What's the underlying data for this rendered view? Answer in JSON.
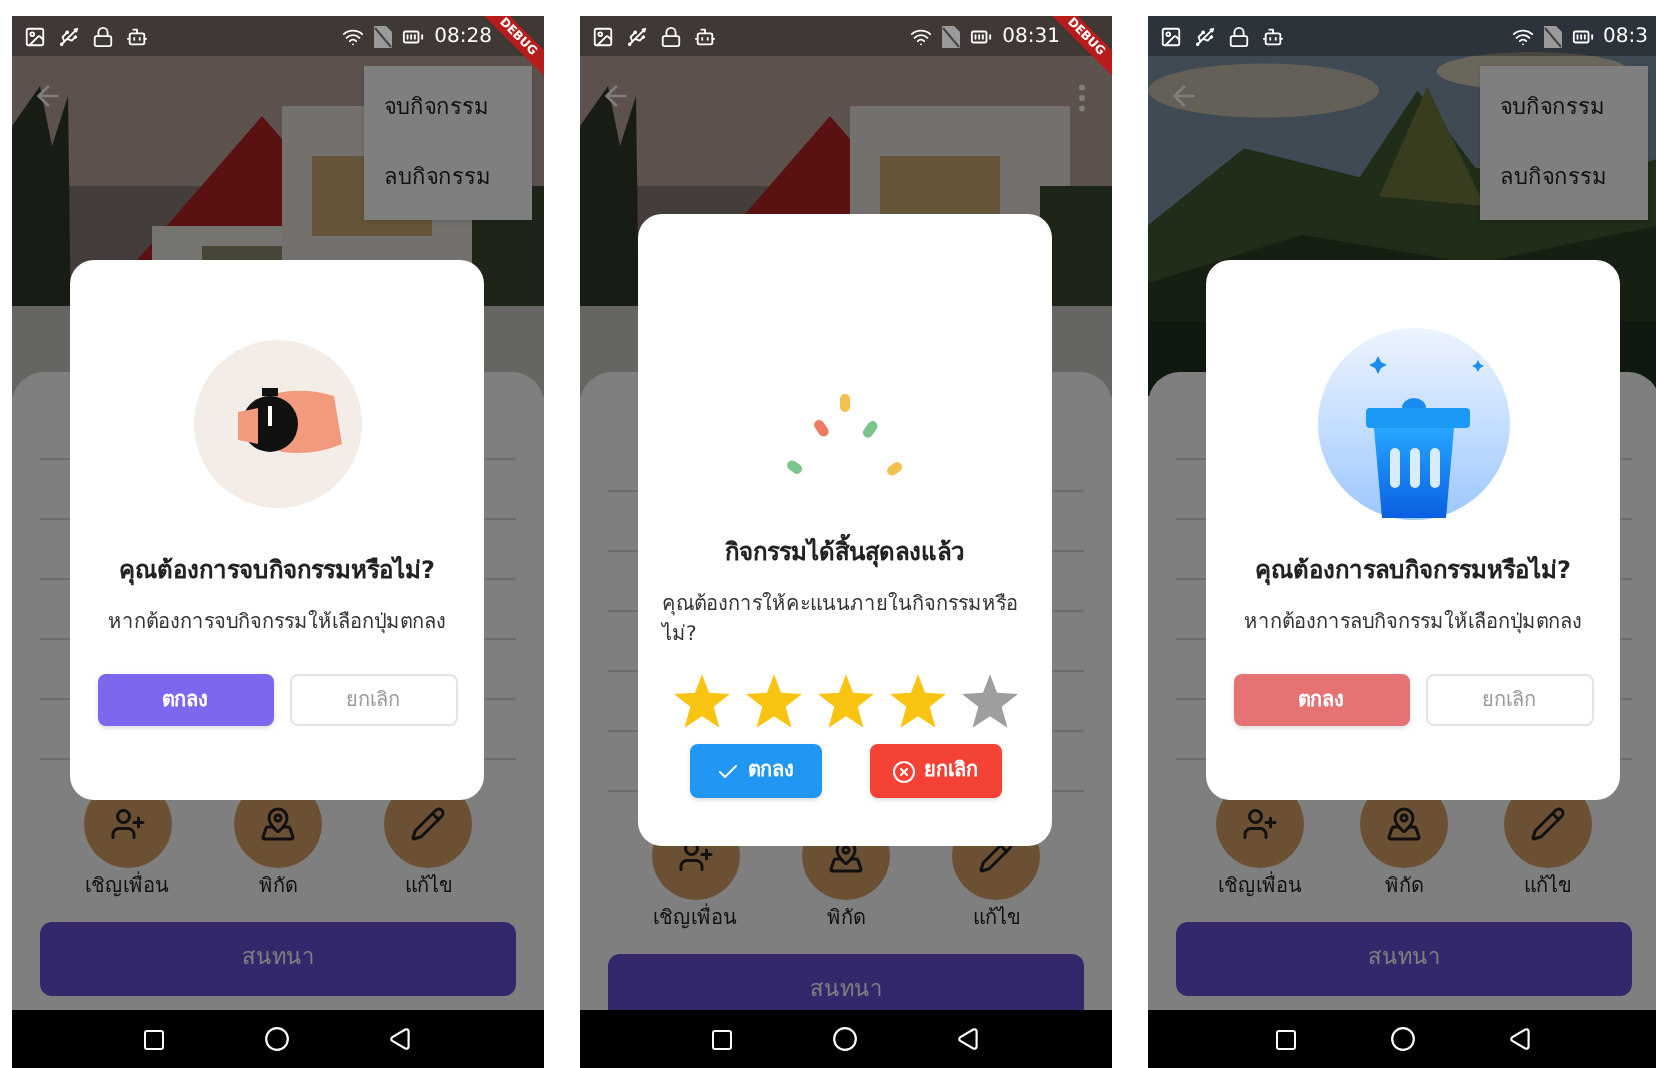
{
  "phones": [
    {
      "status_time": "08:28",
      "debug_banner": "DEBUG",
      "menu": {
        "items": [
          "จบกิจกรรม",
          "ลบกิจกรรม"
        ]
      },
      "actions": [
        "เชิญเพื่อน",
        "พิกัด",
        "แก้ไข"
      ],
      "chat_button": "สนทนา",
      "dialog": {
        "kind": "end_confirm",
        "title": "คุณต้องการจบกิจกรรมหรือไม่?",
        "message": "หากต้องการจบกิจกรรมให้เลือกปุ่มตกลง",
        "ok": "ตกลง",
        "cancel": "ยกเลิก"
      }
    },
    {
      "status_time": "08:31",
      "debug_banner": "DEBUG",
      "actions": [
        "เชิญเพื่อน",
        "พิกัด",
        "แก้ไข"
      ],
      "chat_button": "สนทนา",
      "dialog": {
        "kind": "rating",
        "title": "กิจกรรมได้สิ้นสุดลงแล้ว",
        "message": "คุณต้องการให้คะแนนภายในกิจกรรมหรือไม่?",
        "stars": 4,
        "ok": "ตกลง",
        "cancel": "ยกเลิก"
      }
    },
    {
      "status_time": "08:3",
      "menu": {
        "items": [
          "จบกิจกรรม",
          "ลบกิจกรรม"
        ]
      },
      "actions": [
        "เชิญเพื่อน",
        "พิกัด",
        "แก้ไข"
      ],
      "chat_button": "สนทนา",
      "dialog": {
        "kind": "delete_confirm",
        "title": "คุณต้องการลบกิจกรรมหรือไม่?",
        "message": "หากต้องการลบกิจกรรมให้เลือกปุ่มตกลง",
        "ok": "ตกลง",
        "cancel": "ยกเลิก"
      }
    }
  ]
}
